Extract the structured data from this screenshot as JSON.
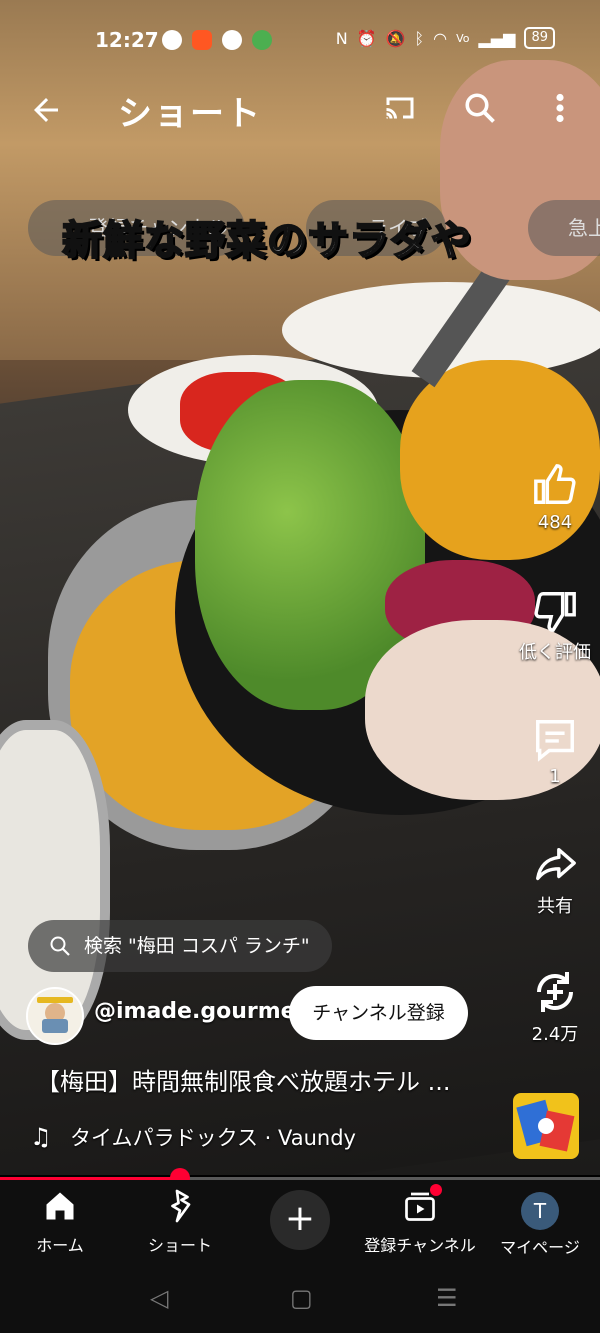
{
  "status_bar": {
    "time": "12:27",
    "battery": "89"
  },
  "header": {
    "title": "ショート"
  },
  "chips": [
    "登録チャンネル",
    "ライブ",
    "急上"
  ],
  "video_caption": "新鮮な野菜のサラダや",
  "actions": {
    "like_count": "484",
    "dislike_label": "低く評価",
    "comment_count": "1",
    "share_label": "共有",
    "remix_count": "2.4万"
  },
  "search": {
    "query": "検索 \"梅田 コスパ ランチ\""
  },
  "channel": {
    "handle": "@imade.gourmet",
    "subscribe_label": "チャンネル登録"
  },
  "video": {
    "title": "【梅田】時間無制限食べ放題ホテル ...",
    "music": "タイムパラドックス · Vaundy",
    "progress": 0.3
  },
  "nav": {
    "home": "ホーム",
    "shorts": "ショート",
    "subscriptions": "登録チャンネル",
    "me": "マイページ",
    "me_initial": "T"
  },
  "colors": {
    "accent": "#ff0033"
  }
}
